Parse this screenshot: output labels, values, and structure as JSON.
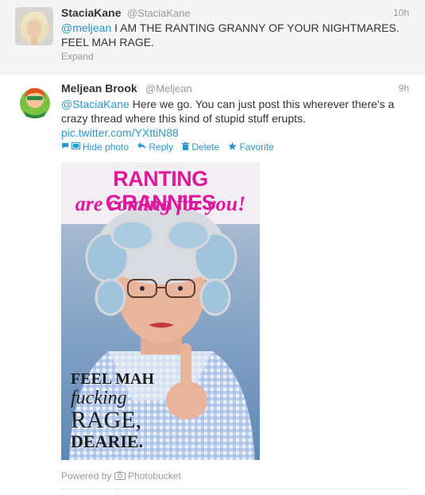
{
  "tweets": [
    {
      "name": "StaciaKane",
      "handle": "@StaciaKane",
      "time": "10h",
      "mention": "@meljean",
      "line1_rest": " I AM THE RANTING GRANNY OF YOUR NIGHTMARES.",
      "line2": "FEEL MAH RAGE.",
      "expand": "Expand"
    },
    {
      "name": "Meljean Brook",
      "handle": "@Meljean",
      "time": "9h",
      "mention": "@StaciaKane",
      "line1_rest": " Here we go. You can just post this wherever there's a",
      "line2": "crazy thread where this kind of stupid stuff erupts.",
      "link": "pic.twitter.com/YXttiN88",
      "actions": {
        "hide_photo": "Hide photo",
        "reply": "Reply",
        "delete": "Delete",
        "favorite": "Favorite"
      },
      "media": {
        "headline": "RANTING GRANNIES",
        "subline": "are coming for you!",
        "caption": [
          "FEEL MAH",
          "fucking",
          "RAGE,",
          "DEARIE."
        ]
      },
      "powered_by": "Powered by",
      "powered_service": "Photobucket"
    }
  ],
  "colors": {
    "link": "#2a97c9",
    "muted": "#999999",
    "headline_magenta": "#e0189c",
    "headline_band": "#f3edf4"
  },
  "icons": [
    "speech-bubble-icon",
    "photo-icon",
    "reply-arrow-icon",
    "trash-icon",
    "star-icon",
    "camera-icon"
  ]
}
